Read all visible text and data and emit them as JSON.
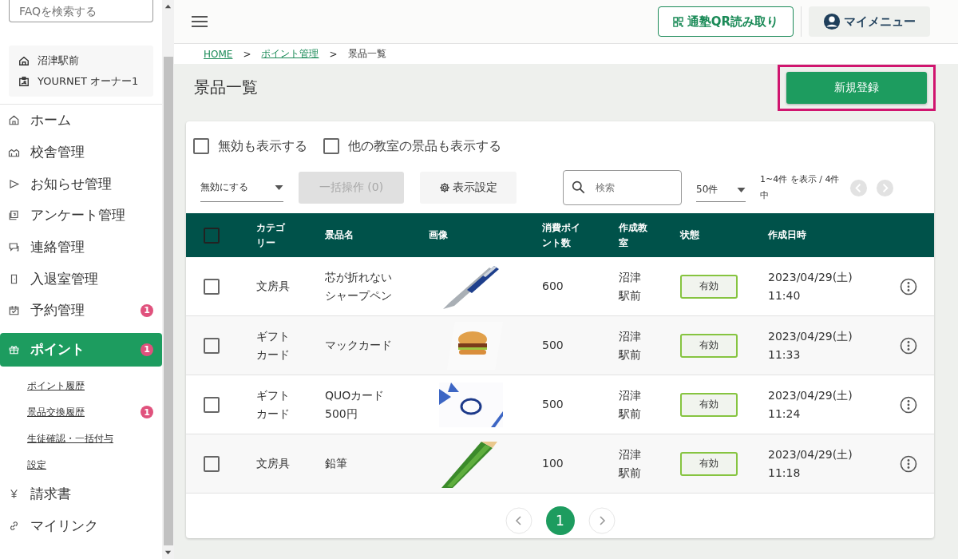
{
  "sidebar": {
    "faq_search": {
      "placeholder": "FAQを検索する"
    },
    "location": {
      "school": "沼津駅前",
      "user": "YOURNET オーナー1"
    },
    "items": [
      {
        "label": "ホーム",
        "selected": false
      },
      {
        "label": "校舎管理",
        "selected": false
      },
      {
        "label": "お知らせ管理",
        "selected": false
      },
      {
        "label": "アンケート管理",
        "selected": false
      },
      {
        "label": "連絡管理",
        "selected": false
      },
      {
        "label": "入退室管理",
        "selected": false
      },
      {
        "label": "予約管理",
        "selected": false,
        "badge": "1"
      },
      {
        "label": "ポイント",
        "selected": true,
        "badge": "1",
        "children": [
          {
            "label": "ポイント履歴"
          },
          {
            "label": "景品交換履歴",
            "badge": "1"
          },
          {
            "label": "生徒確認・一括付与"
          },
          {
            "label": "設定"
          }
        ]
      },
      {
        "label": "請求書",
        "selected": false
      },
      {
        "label": "マイリンク",
        "selected": false
      }
    ]
  },
  "header": {
    "qr_button": "通塾QR読み取り",
    "my_menu": "マイメニュー"
  },
  "breadcrumb": [
    {
      "kind": "link",
      "label": "HOME"
    },
    {
      "kind": "separator",
      "label": ">"
    },
    {
      "kind": "link",
      "label": "ポイント管理"
    },
    {
      "kind": "separator",
      "label": ">"
    },
    {
      "kind": "current",
      "label": "景品一覧"
    }
  ],
  "page_title": "景品一覧",
  "new_button": "新規登録",
  "filters": [
    {
      "label": "無効も表示する",
      "checked": false
    },
    {
      "label": "他の教室の景品も表示する",
      "checked": false
    }
  ],
  "toolbar": {
    "action_select": "無効にする",
    "bulk_button": "一括操作 (0)",
    "bulk_disabled": true,
    "display_settings": "表示設定",
    "search": {
      "placeholder": "検索"
    },
    "per_page": "50件",
    "range": "1~4件 を表示 / 4件中"
  },
  "table": {
    "all_selected": false,
    "columns": [
      "カテゴリー",
      "景品名",
      "画像",
      "消費ポイント数",
      "作成教室",
      "状態",
      "作成日時"
    ],
    "rows": [
      {
        "selected": false,
        "category": "文房具",
        "name": "芯が折れないシャープペン",
        "points": "600",
        "classroom": "沼津駅前",
        "status": "有効",
        "created": "2023/04/29(土) 11:40"
      },
      {
        "selected": false,
        "category": "ギフトカード",
        "name": "マックカード",
        "points": "500",
        "classroom": "沼津駅前",
        "status": "有効",
        "created": "2023/04/29(土) 11:33"
      },
      {
        "selected": false,
        "category": "ギフトカード",
        "name": "QUOカード500円",
        "points": "500",
        "classroom": "沼津駅前",
        "status": "有効",
        "created": "2023/04/29(土) 11:24"
      },
      {
        "selected": false,
        "category": "文房具",
        "name": "鉛筆",
        "points": "100",
        "classroom": "沼津駅前",
        "status": "有効",
        "created": "2023/04/29(土) 11:18"
      }
    ]
  },
  "pagination": {
    "pages": [
      {
        "label": "1",
        "selected": true
      }
    ]
  }
}
